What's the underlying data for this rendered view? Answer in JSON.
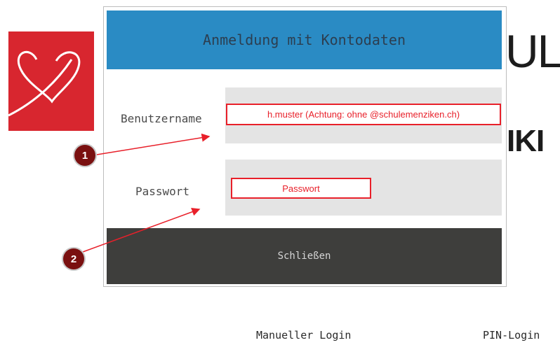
{
  "dialog": {
    "title": "Anmeldung mit Kontodaten",
    "username_label": "Benutzername",
    "username_hint": "h.muster (Achtung: ohne @schulemenziken.ch)",
    "password_label": "Passwort",
    "password_hint": "Passwort",
    "close_label": "Schließen"
  },
  "background": {
    "brand_line1": "UL",
    "brand_line2": "IKI",
    "logo_icon": "heart-logo-icon",
    "manual_login": "Manueller Login",
    "pin_login": "PIN-Login"
  },
  "annotations": {
    "marker1": "1",
    "marker2": "2",
    "color": "#e8202a",
    "marker_color": "#7a1010"
  },
  "colors": {
    "header": "#2a8bc4",
    "close_button": "#3e3e3c",
    "logo_red": "#d8262f",
    "field_bg": "#e4e4e4"
  }
}
